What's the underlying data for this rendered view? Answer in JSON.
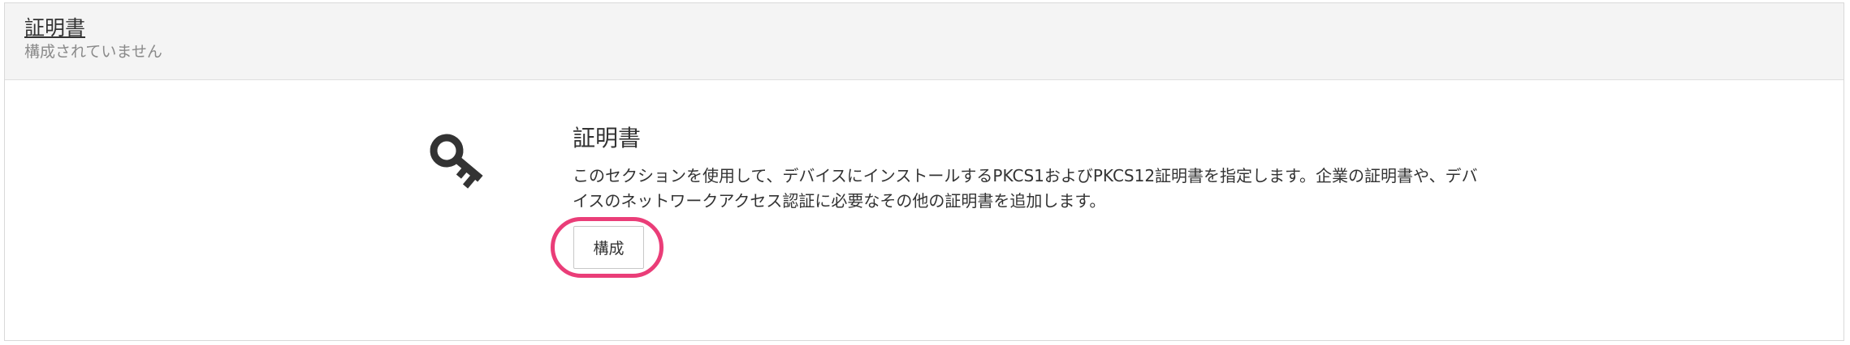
{
  "header": {
    "title": "証明書",
    "subtitle": "構成されていません"
  },
  "section": {
    "icon": "key-icon",
    "title": "証明書",
    "description": "このセクションを使用して、デバイスにインストールするPKCS1およびPKCS12証明書を指定します。企業の証明書や、デバイスのネットワークアクセス認証に必要なその他の証明書を追加します。",
    "configure_label": "構成"
  },
  "colors": {
    "header_bg": "#f4f4f4",
    "highlight": "#ea3d78",
    "text": "#333333",
    "muted_text": "#8a8a8a"
  }
}
